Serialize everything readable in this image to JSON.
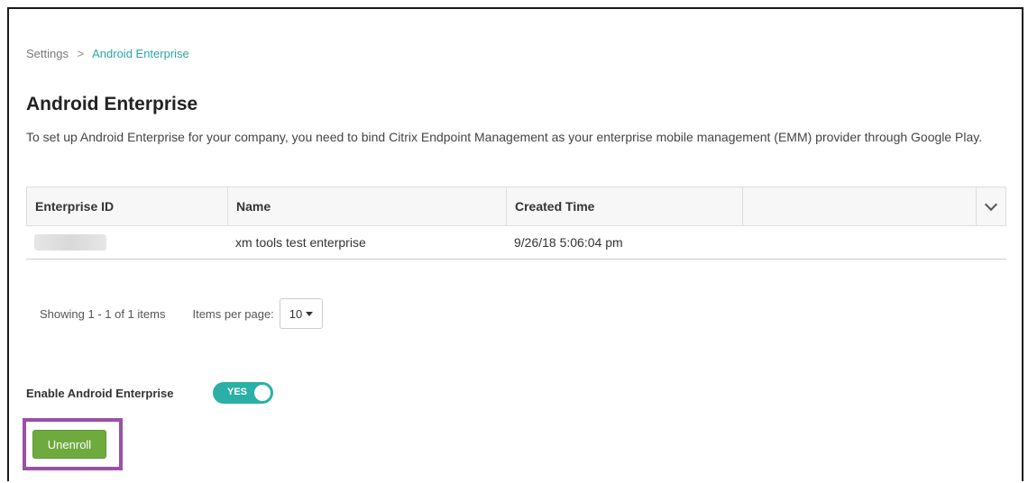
{
  "breadcrumb": {
    "root": "Settings",
    "separator": ">",
    "current": "Android Enterprise"
  },
  "page": {
    "title": "Android Enterprise",
    "description": "To set up Android Enterprise for your company, you need to bind Citrix Endpoint Management as your enterprise mobile management (EMM) provider through Google Play."
  },
  "table": {
    "columns": [
      "Enterprise ID",
      "Name",
      "Created Time",
      ""
    ],
    "column_menu_icon": "chevron-down-icon",
    "rows": [
      {
        "enterprise_id": "",
        "name": "xm tools test enterprise",
        "created_time": "9/26/18 5:06:04 pm"
      }
    ]
  },
  "pager": {
    "showing": "Showing 1 - 1 of 1 items",
    "items_per_page_label": "Items per page:",
    "items_per_page_value": "10"
  },
  "enable": {
    "label": "Enable Android Enterprise",
    "toggle_text": "YES",
    "toggle_on": true
  },
  "actions": {
    "unenroll_label": "Unenroll"
  },
  "colors": {
    "accent": "#2ab0a6",
    "link": "#2aa6a1",
    "button": "#6faa3e",
    "highlight": "#9b4fa8"
  }
}
